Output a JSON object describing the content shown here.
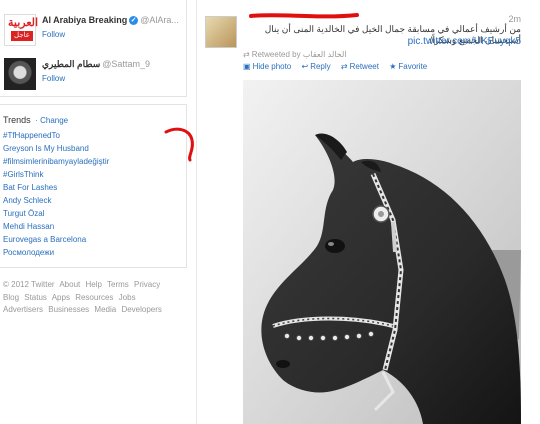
{
  "sidebar": {
    "who_to_follow": [
      {
        "name": "Al Arabiya Breaking",
        "handle": "@AlAra...",
        "follow_label": "Follow",
        "logo_text_top": "العربية",
        "logo_text_bottom": "عاجل"
      },
      {
        "name": "سطام المطيري",
        "handle": "@Sattam_9",
        "follow_label": "Follow"
      }
    ],
    "trends": {
      "title": "Trends",
      "change_label": "· Change",
      "items": [
        "#TfHappenedTo",
        "Greyson Is My Husband",
        "#filmsimlerinibamyayladeğiştir",
        "#GirlsThink",
        "Bat For Lashes",
        "Andy Schleck",
        "Turgut Özal",
        "Mehdi Hassan",
        "Eurovegas a Barcelona",
        "Росмолодежи"
      ]
    },
    "footer": {
      "line1": [
        "© 2012 Twitter",
        "About",
        "Help",
        "Terms",
        "Privacy"
      ],
      "line2": [
        "Blog",
        "Status",
        "Apps",
        "Resources",
        "Jobs"
      ],
      "line3": [
        "Advertisers",
        "Businesses",
        "Media",
        "Developers"
      ]
    }
  },
  "tweet": {
    "time": "2m",
    "text": "من أرشيف أعمالي في مسابقة جمال الخيل في الخالدية المنى أن ينال أستحسان الجميع وشكراً/",
    "link": "pic.twitter.com/UKEuyqk5",
    "retweeted_by_label": "Retweeted by",
    "retweeted_by_name": "الخالد العقاب",
    "actions": {
      "hide_photo": "Hide photo",
      "reply": "Reply",
      "retweet": "Retweet",
      "favorite": "Favorite"
    }
  },
  "colors": {
    "link": "#2a6fbd",
    "annotation_red": "#e01010"
  }
}
